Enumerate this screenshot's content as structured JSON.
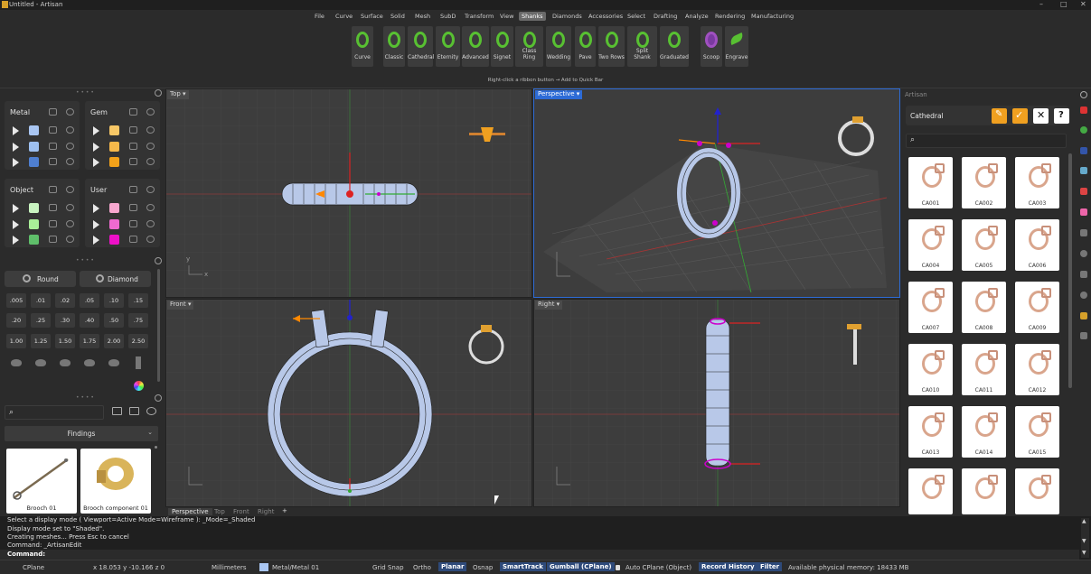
{
  "titlebar": {
    "title": "Untitled - Artisan",
    "window_controls": [
      "–",
      "□",
      "✕"
    ]
  },
  "menu": {
    "items": [
      "File",
      "Curve",
      "Surface",
      "Solid",
      "Mesh",
      "SubD",
      "Transform",
      "View",
      "Shanks",
      "Diamonds",
      "Accessories",
      "Select",
      "Drafting",
      "Analyze",
      "Rendering",
      "Manufacturing"
    ],
    "active": "Shanks"
  },
  "ribbon": {
    "buttons": [
      "Curve",
      "Classic",
      "Cathedral",
      "Eternity",
      "Advanced",
      "Signet",
      "Class Ring",
      "Wedding",
      "Pave",
      "Two Rows",
      "Split Shank",
      "Graduated",
      "Scoop",
      "Engrave"
    ],
    "hint": "Right-click a ribbon button → Add to Quick Bar"
  },
  "layers": {
    "groups": [
      {
        "title": "Metal",
        "colors": [
          "#a9c6f2",
          "#9ec0f0",
          "#4f7fd0"
        ]
      },
      {
        "title": "Gem",
        "colors": [
          "#f7c766",
          "#f6b84a",
          "#f3a21a"
        ]
      },
      {
        "title": "Object",
        "colors": [
          "#c8f3c0",
          "#a9ee98",
          "#5fbf6a"
        ]
      },
      {
        "title": "User",
        "colors": [
          "#f7a7cf",
          "#f06ad0",
          "#ee10c8"
        ]
      }
    ]
  },
  "gem_tools": {
    "shape_buttons": [
      "Round",
      "Diamond"
    ],
    "sizes_row1": [
      ".005",
      ".01",
      ".02",
      ".05",
      ".10",
      ".15"
    ],
    "sizes_row2": [
      ".20",
      ".25",
      ".30",
      ".40",
      ".50",
      ".75"
    ],
    "sizes_row3": [
      "1.00",
      "1.25",
      "1.50",
      "1.75",
      "2.00",
      "2.50"
    ]
  },
  "library": {
    "search_placeholder": "",
    "category": "Findings",
    "items": [
      "Brooch 01",
      "Brooch component 01"
    ]
  },
  "viewports": {
    "top": "Top",
    "perspective": "Perspective",
    "front": "Front",
    "right": "Right",
    "tabs": [
      "Perspective",
      "Top",
      "Front",
      "Right"
    ],
    "add_tab": "+"
  },
  "artisan": {
    "panel_title": "Artisan",
    "category": "Cathedral",
    "help": "?",
    "thumbnails": [
      "CA001",
      "CA002",
      "CA003",
      "CA004",
      "CA005",
      "CA006",
      "CA007",
      "CA008",
      "CA009",
      "CA010",
      "CA011",
      "CA012",
      "CA013",
      "CA014",
      "CA015",
      "",
      "",
      " "
    ]
  },
  "command": {
    "history": [
      "Select a display mode ( Viewport=Active  Mode=Wireframe ): _Mode=_Shaded",
      "Display mode set to \"Shaded\".",
      "Creating meshes... Press Esc to cancel",
      "Command: _ArtisanEdit"
    ],
    "prompt": "Command:"
  },
  "status": {
    "cplane": "CPlane",
    "coords": "x 18.053  y -10.166  z 0",
    "units": "Millimeters",
    "layer": "Metal/Metal 01",
    "toggles": [
      {
        "label": "Grid Snap",
        "on": false
      },
      {
        "label": "Ortho",
        "on": false
      },
      {
        "label": "Planar",
        "on": true
      },
      {
        "label": "Osnap",
        "on": false
      },
      {
        "label": "SmartTrack",
        "on": true
      },
      {
        "label": "Gumball (CPlane)",
        "on": true
      }
    ],
    "auto_cplane": "Auto CPlane (Object)",
    "record_history": "Record History",
    "filter": "Filter",
    "memory": "Available physical memory: 18433 MB"
  }
}
